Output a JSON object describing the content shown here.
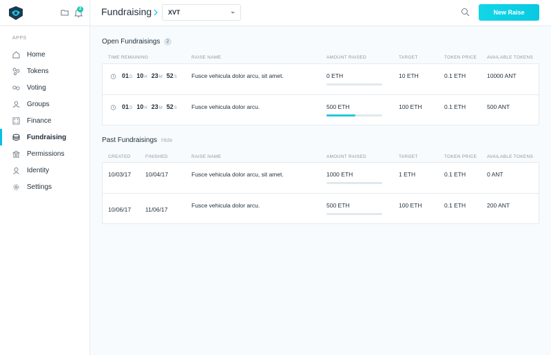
{
  "sidebar": {
    "apps_label": "APPS",
    "notification_count": "2",
    "items": [
      {
        "label": "Home",
        "icon": "home-icon"
      },
      {
        "label": "Tokens",
        "icon": "tokens-icon"
      },
      {
        "label": "Voting",
        "icon": "voting-icon"
      },
      {
        "label": "Groups",
        "icon": "groups-icon"
      },
      {
        "label": "Finance",
        "icon": "finance-icon"
      },
      {
        "label": "Fundraising",
        "icon": "fundraising-icon",
        "active": true
      },
      {
        "label": "Permissions",
        "icon": "permissions-icon"
      },
      {
        "label": "Identity",
        "icon": "identity-icon"
      },
      {
        "label": "Settings",
        "icon": "settings-icon"
      }
    ]
  },
  "header": {
    "title": "Fundraising",
    "token_select": "XVT",
    "new_raise_label": "New Raise"
  },
  "open": {
    "title": "Open Fundraisings",
    "count": "2",
    "columns": [
      "TIME REMAINING",
      "RAISE NAME",
      "AMOUNT RAISED",
      "TARGET",
      "TOKEN PRICE",
      "AVAILABLE TOKENS"
    ],
    "rows": [
      {
        "days": "01",
        "hours": "10",
        "minutes": "23",
        "seconds": "52",
        "d": "D",
        "h": "H",
        "m": "M",
        "s": "S",
        "name": "Fusce vehicula dolor arcu, sit amet.",
        "amount": "0 ETH",
        "progress": 0,
        "target": "10 ETH",
        "price": "0.1 ETH",
        "available": "10000 ANT"
      },
      {
        "days": "01",
        "hours": "10",
        "minutes": "23",
        "seconds": "52",
        "d": "D",
        "h": "H",
        "m": "M",
        "s": "S",
        "name": "Fusce vehicula dolor arcu.",
        "amount": "500 ETH",
        "progress": 0.52,
        "target": "100 ETH",
        "price": "0.1 ETH",
        "available": "500 ANT"
      }
    ]
  },
  "past": {
    "title": "Past Fundraisings",
    "hide_label": "Hide",
    "columns": [
      "CREATED",
      "FINISHED",
      "RAISE NAME",
      "AMOUNT RAISED",
      "TARGET",
      "TOKEN PRICE",
      "AVAILABLE TOKENS"
    ],
    "rows": [
      {
        "created": "10/03/17",
        "finished": "10/04/17",
        "name": "Fusce vehicula dolor arcu, sit amet.",
        "amount": "1000 ETH",
        "progress": 0,
        "target": "1 ETH",
        "price": "0.1 ETH",
        "available": "0 ANT"
      },
      {
        "created": "10/06/17",
        "finished": "11/06/17",
        "name": "Fusce vehicula dolor arcu.",
        "amount": "500 ETH",
        "progress": 0,
        "target": "100 ETH",
        "price": "0.1 ETH",
        "available": "200 ANT"
      }
    ]
  },
  "colors": {
    "accent": "#08bee5",
    "progress": "#21c8d8",
    "badge": "#21c8b0"
  }
}
